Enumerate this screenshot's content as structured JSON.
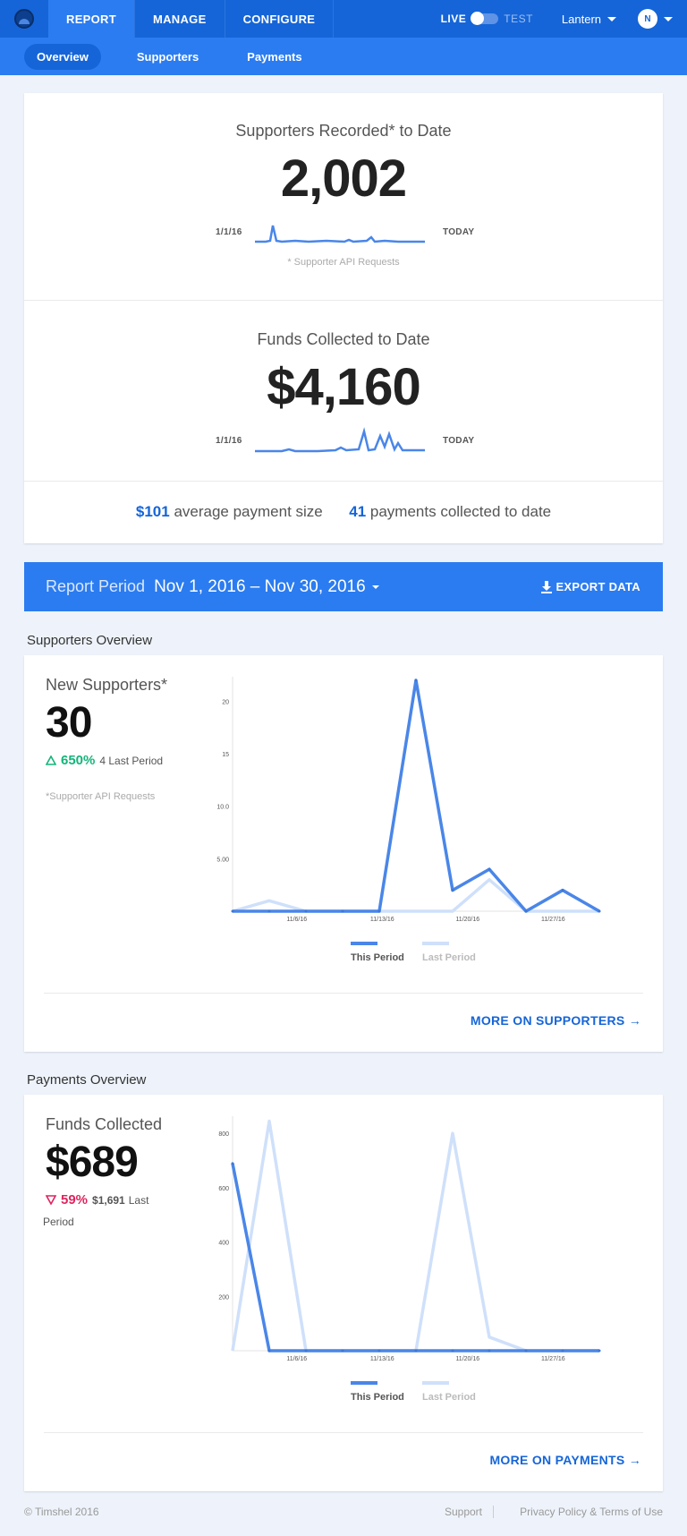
{
  "nav": {
    "tabs": [
      "REPORT",
      "MANAGE",
      "CONFIGURE"
    ],
    "live_label": "LIVE",
    "test_label": "TEST",
    "org_name": "Lantern",
    "avatar_initial": "N"
  },
  "subnav": {
    "tabs": [
      "Overview",
      "Supporters",
      "Payments"
    ]
  },
  "summary": {
    "supporters_title": "Supporters Recorded* to Date",
    "supporters_value": "2,002",
    "start_label": "1/1/16",
    "end_label": "TODAY",
    "supporters_footnote": "* Supporter API Requests",
    "funds_title": "Funds Collected to Date",
    "funds_value": "$4,160",
    "avg_payment_value": "$101",
    "avg_payment_label": "average payment size",
    "payments_count_value": "41",
    "payments_count_label": "payments collected to date"
  },
  "report_period": {
    "label": "Report Period",
    "value": "Nov 1, 2016 – Nov 30, 2016",
    "export_label": "EXPORT DATA"
  },
  "supporters_overview": {
    "section_label": "Supporters Overview",
    "metric_title": "New Supporters*",
    "metric_value": "30",
    "change_pct": "650%",
    "last_period_text": "4 Last Period",
    "footnote": "*Supporter API Requests",
    "more_link": "MORE ON SUPPORTERS →"
  },
  "payments_overview": {
    "section_label": "Payments Overview",
    "metric_title": "Funds Collected",
    "metric_value": "$689",
    "change_pct": "59%",
    "last_period_amount": "$1,691",
    "last_period_text": "Last",
    "last_period_text2": "Period",
    "more_link": "MORE ON PAYMENTS →"
  },
  "legend": {
    "this_period": "This Period",
    "last_period": "Last Period"
  },
  "colors": {
    "this_period": "#4a86e8",
    "last_period": "#cfe0fa",
    "primary": "#1565d8",
    "up": "#14b57a",
    "down": "#e0245e"
  },
  "footer": {
    "copyright": "© Timshel 2016",
    "support": "Support",
    "privacy": "Privacy Policy & Terms of Use"
  },
  "chart_data": [
    {
      "type": "line",
      "x_tick_labels": [
        "11/6/16",
        "11/13/16",
        "11/20/16",
        "11/27/16"
      ],
      "y_tick_labels": [
        "5.00",
        "10.0",
        "15",
        "20"
      ],
      "ylim": [
        0,
        22
      ],
      "series": [
        {
          "name": "This Period",
          "values": [
            0,
            0,
            0,
            0,
            0,
            22,
            2,
            4,
            0,
            2,
            0
          ]
        },
        {
          "name": "Last Period",
          "values": [
            0,
            1,
            0,
            0,
            0,
            0,
            0,
            3,
            0,
            0,
            0
          ]
        }
      ],
      "grid": false,
      "legend": "bottom"
    },
    {
      "type": "line",
      "x_tick_labels": [
        "11/6/16",
        "11/13/16",
        "11/20/16",
        "11/27/16"
      ],
      "y_tick_labels": [
        "200",
        "400",
        "600",
        "800"
      ],
      "ylim": [
        0,
        850
      ],
      "series": [
        {
          "name": "This Period",
          "values": [
            689,
            0,
            0,
            0,
            0,
            0,
            0,
            0,
            0,
            0,
            0
          ]
        },
        {
          "name": "Last Period",
          "values": [
            0,
            845,
            0,
            0,
            0,
            0,
            800,
            50,
            0,
            0,
            0
          ]
        }
      ],
      "grid": false,
      "legend": "bottom"
    }
  ]
}
